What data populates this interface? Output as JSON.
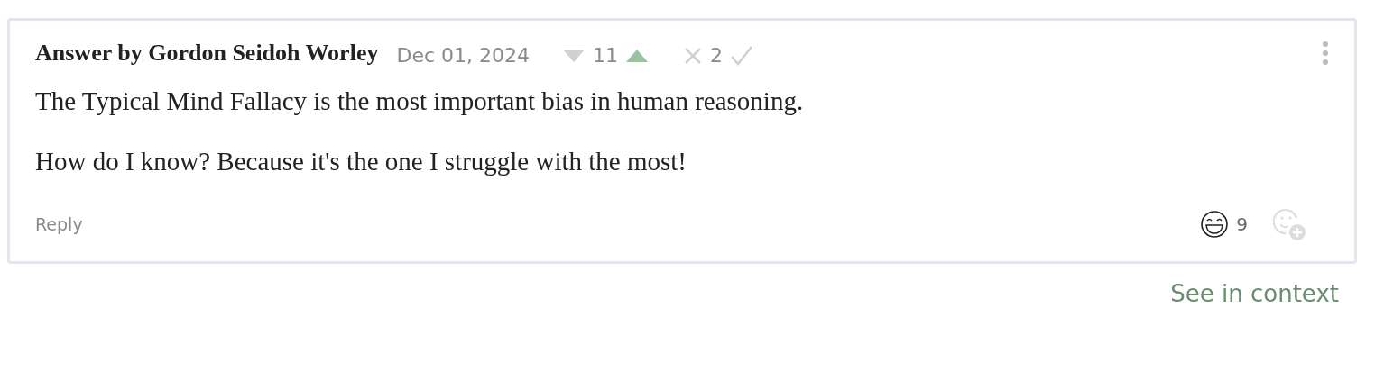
{
  "answer": {
    "author": "Answer by Gordon Seidoh Worley",
    "date": "Dec 01, 2024",
    "karma": {
      "score": "11",
      "downvoted": false,
      "upvoted": true
    },
    "agreement": {
      "score": "2",
      "disagreed": false,
      "agreed": false
    },
    "paragraphs": [
      "The Typical Mind Fallacy is the most important bias in human reasoning.",
      "How do I know? Because it's the one I struggle with the most!"
    ],
    "reply": "Reply",
    "reactions": [
      {
        "count": "9"
      }
    ]
  },
  "context_link": "See in context"
}
